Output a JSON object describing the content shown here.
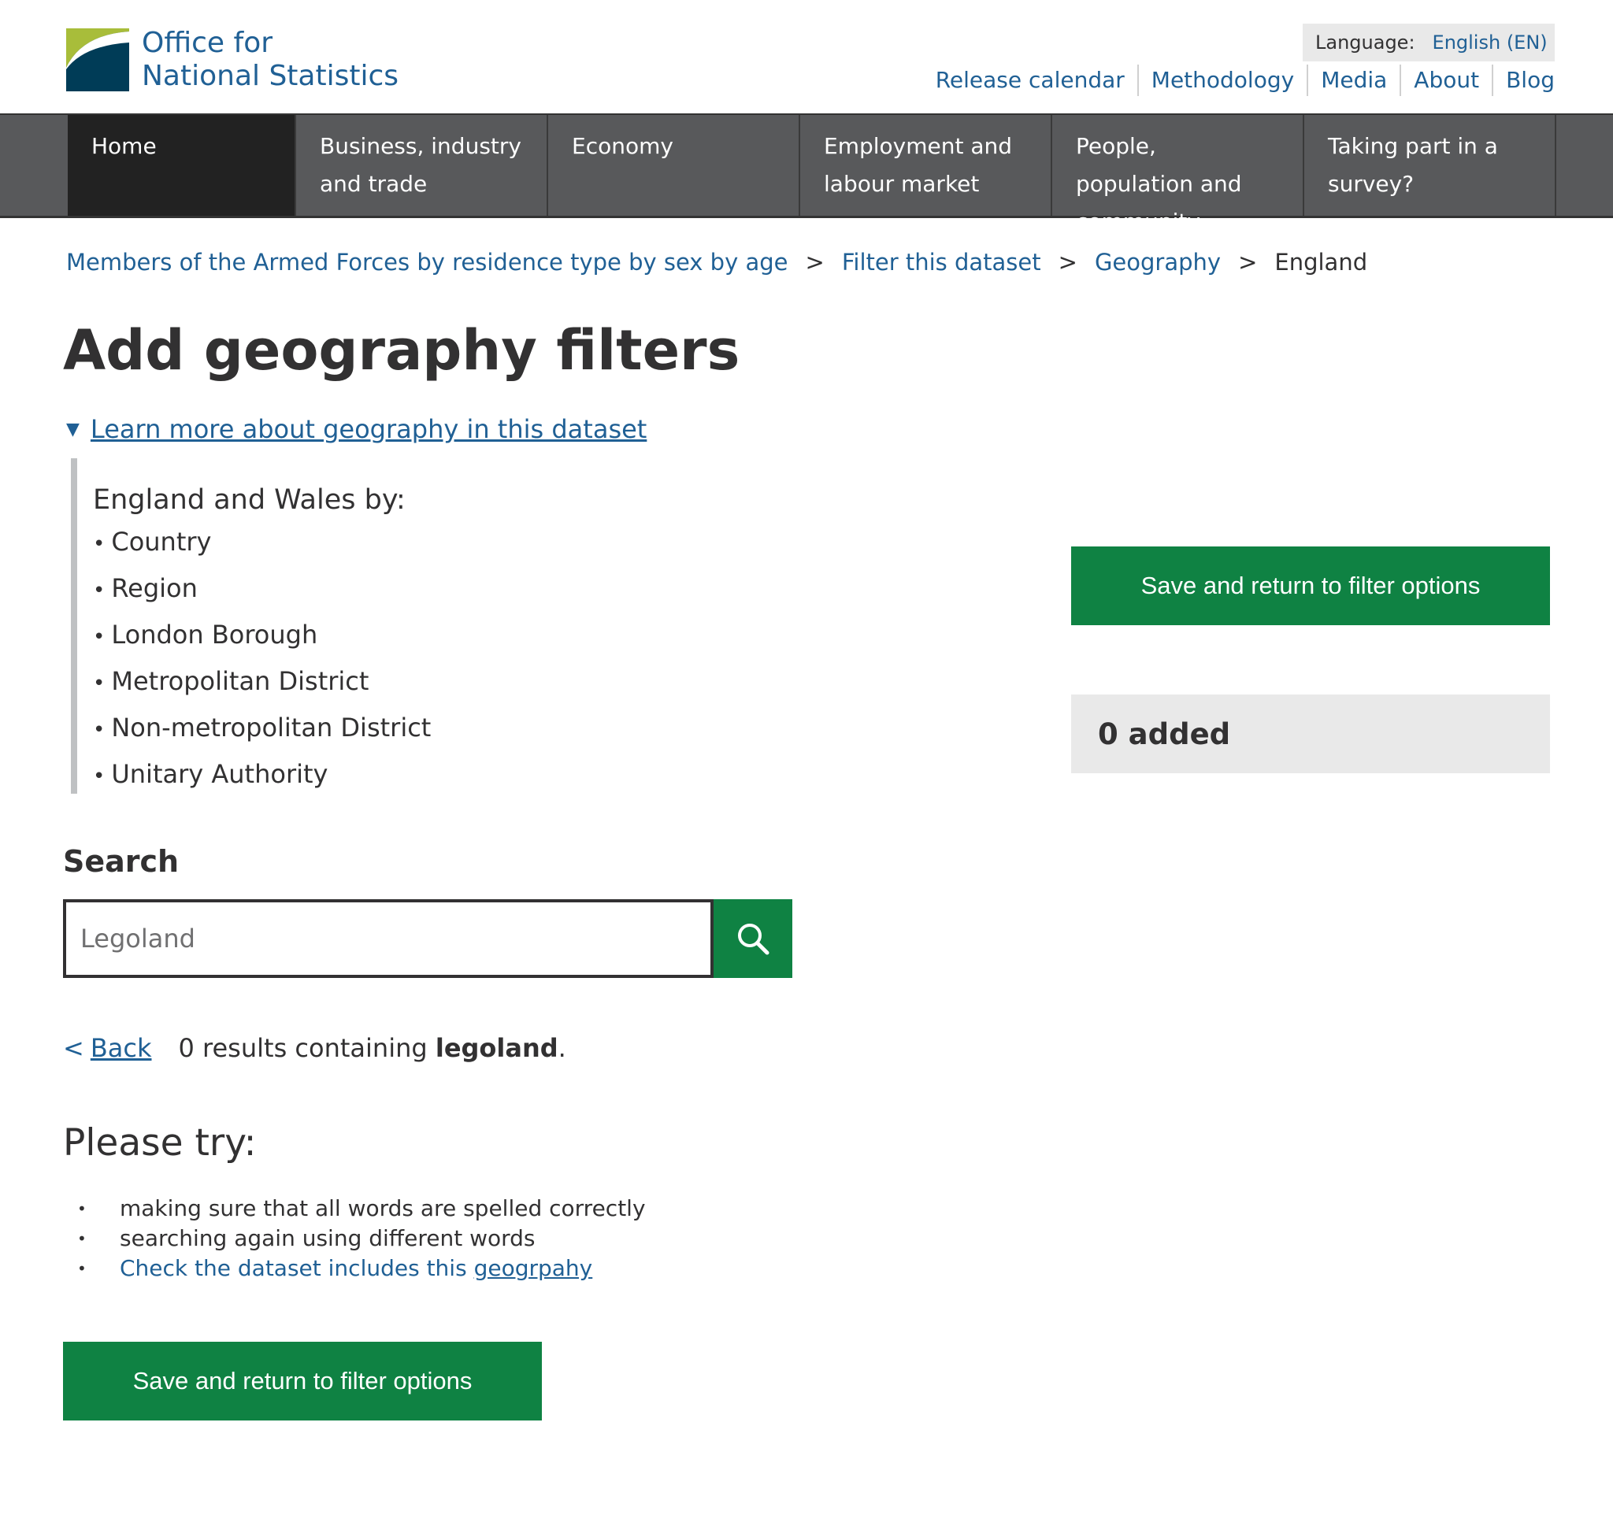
{
  "header": {
    "logo_line1": "Office for",
    "logo_line2": "National Statistics",
    "language_label": "Language:",
    "language_value": "English (EN)",
    "util_links": [
      "Release calendar",
      "Methodology",
      "Media",
      "About",
      "Blog"
    ]
  },
  "nav": {
    "items": [
      {
        "label": "Home"
      },
      {
        "label": "Business, industry and trade"
      },
      {
        "label": "Economy"
      },
      {
        "label": "Employment and labour market"
      },
      {
        "label": "People, population and community"
      },
      {
        "label": "Taking part in a survey?"
      }
    ]
  },
  "breadcrumb": {
    "items": [
      "Members of the Armed Forces by residence type by sex by age",
      "Filter this dataset",
      "Geography"
    ],
    "separator": ">",
    "current": "England"
  },
  "page": {
    "title": "Add geography filters"
  },
  "details": {
    "summary": "Learn more about geography in this dataset",
    "heading": "England and Wales by:",
    "items": [
      "Country",
      "Region",
      "London Borough",
      "Metropolitan District",
      "Non-metropolitan District",
      "Unitary Authority"
    ]
  },
  "sidebar": {
    "save_label": "Save and return to filter options",
    "added_label": "0 added"
  },
  "search": {
    "label": "Search",
    "value": "Legoland"
  },
  "results": {
    "back_chevron": "<",
    "back_label": "Back",
    "text_prefix": "0 results containing ",
    "term": "legoland",
    "text_suffix": "."
  },
  "suggestions": {
    "heading": "Please try:",
    "tip1": "making sure that all words are spelled correctly",
    "tip2": "searching again using different words",
    "tip3_prefix": "Check the dataset includes this ",
    "tip3_link": "geogrpahy"
  },
  "footer_actions": {
    "save_label": "Save and return to filter options"
  },
  "colors": {
    "brand_blue": "#206095",
    "action_green": "#0f8243",
    "nav_grey": "#58595b",
    "nav_active": "#222222"
  }
}
